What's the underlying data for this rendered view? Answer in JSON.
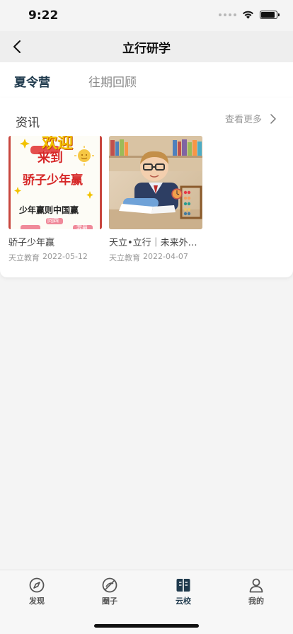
{
  "status_bar": {
    "time": "9:22",
    "battery_level": 0.9
  },
  "nav": {
    "title": "立行研学",
    "back_icon": "chevron-left-icon"
  },
  "tabs": [
    {
      "label": "夏令营",
      "active": true
    },
    {
      "label": "往期回顾",
      "active": false
    }
  ],
  "news": {
    "section_title": "资讯",
    "more_label": "查看更多",
    "articles": [
      {
        "title": "骄子少年赢",
        "source": "天立教育",
        "date": "2022-05-12",
        "poster_texts": [
          "欢迎",
          "来到",
          "骄子少年赢",
          "少年赢则中国赢",
          "同四",
          "奔赢"
        ]
      },
      {
        "title": "天立•立行｜未来外交官",
        "source": "天立教育",
        "date": "2022-04-07"
      }
    ]
  },
  "tabbar": [
    {
      "label": "发现",
      "icon": "compass-icon",
      "active": false
    },
    {
      "label": "圈子",
      "icon": "circle-slash-icon",
      "active": false
    },
    {
      "label": "云校",
      "icon": "book-icon",
      "active": true
    },
    {
      "label": "我的",
      "icon": "person-icon",
      "active": false
    }
  ],
  "colors": {
    "accent": "#1f3a4d",
    "poster_red": "#d62828",
    "poster_yellow": "#f2c200"
  }
}
